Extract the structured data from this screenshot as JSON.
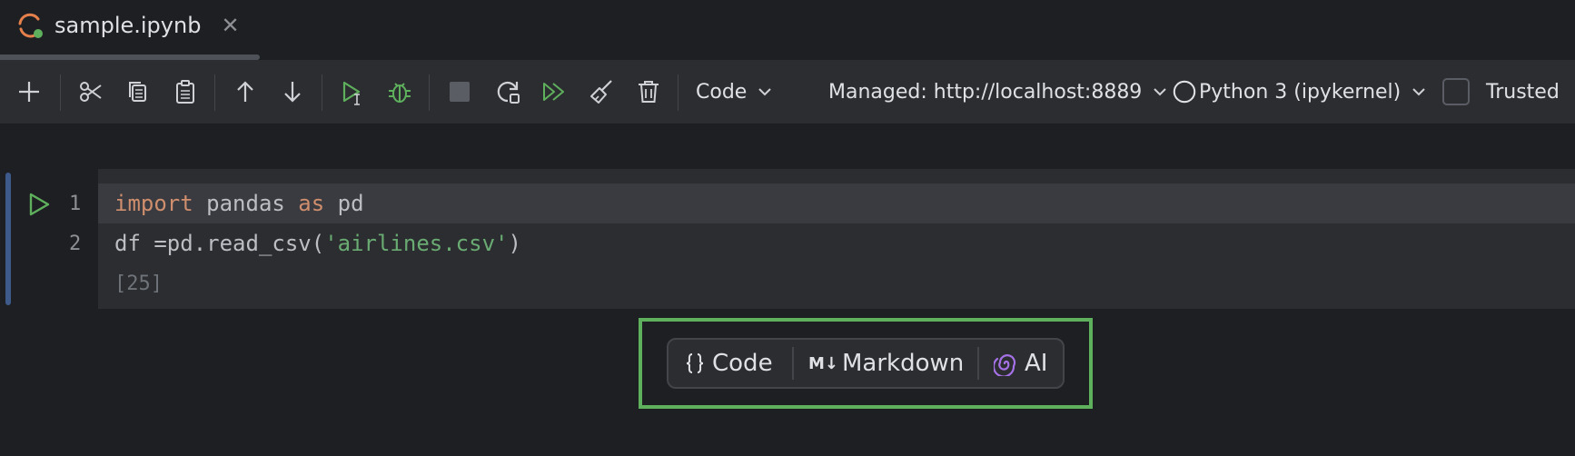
{
  "tab": {
    "title": "sample.ipynb",
    "close_glyph": "✕"
  },
  "toolbar": {
    "cell_type": "Code",
    "server": "Managed: http://localhost:8889",
    "kernel": "Python 3 (ipykernel)",
    "trusted_label": "Trusted",
    "trusted_checked": false
  },
  "cell": {
    "lines": [
      {
        "number": "1",
        "tokens": [
          {
            "text": "import",
            "kind": "keyword"
          },
          {
            "text": " pandas ",
            "kind": "plain"
          },
          {
            "text": "as",
            "kind": "keyword"
          },
          {
            "text": " pd",
            "kind": "plain"
          }
        ]
      },
      {
        "number": "2",
        "tokens": [
          {
            "text": "df =pd.read_csv(",
            "kind": "plain"
          },
          {
            "text": "'airlines.csv'",
            "kind": "string"
          },
          {
            "text": ")",
            "kind": "plain"
          }
        ]
      }
    ],
    "execution_count": "[25]"
  },
  "add_cell_popup": {
    "code_label": "Code",
    "markdown_label": "Markdown",
    "ai_label": "AI",
    "markdown_icon_text": "M↓"
  },
  "colors": {
    "highlight_border": "#5fb05d",
    "run_green": "#5fb05d",
    "keyword": "#cf8e6d",
    "string": "#6aab73",
    "ai_purple": "#a571e6"
  }
}
